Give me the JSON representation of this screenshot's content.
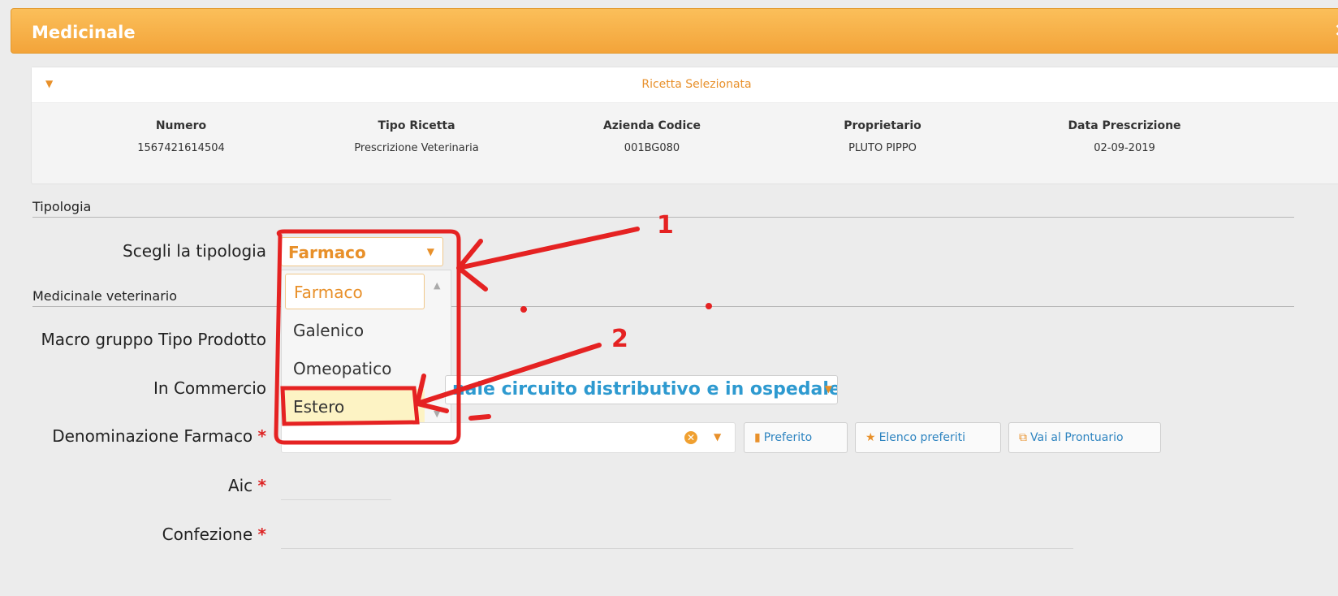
{
  "window": {
    "title": "Medicinale",
    "close_label": "×"
  },
  "ricetta": {
    "header": "Ricetta Selezionata",
    "columns": [
      {
        "label": "Numero",
        "value": "1567421614504"
      },
      {
        "label": "Tipo Ricetta",
        "value": "Prescrizione Veterinaria"
      },
      {
        "label": "Azienda Codice",
        "value": "001BG080"
      },
      {
        "label": "Proprietario",
        "value": "PLUTO PIPPO"
      },
      {
        "label": "Data Prescrizione",
        "value": "02-09-2019"
      }
    ]
  },
  "sections": {
    "tipologia": "Tipologia",
    "medicinale": "Medicinale veterinario"
  },
  "form": {
    "tipologia_label": "Scegli la tipologia",
    "tipologia_value": "Farmaco",
    "tipologia_options": [
      "Farmaco",
      "Galenico",
      "Omeopatico",
      "Estero"
    ],
    "macro_label": "Macro gruppo Tipo Prodotto",
    "commercio_label": "In Commercio",
    "commercio_value": "nale circuito distributivo e in ospedale",
    "denominazione_label": "Denominazione Farmaco",
    "aic_label": "Aic",
    "confezione_label": "Confezione",
    "required_mark": "*"
  },
  "buttons": {
    "preferito": "Preferito",
    "elenco_preferiti": "Elenco preferiti",
    "vai_prontuario": "Vai al Prontuario"
  },
  "annotations": {
    "step1": "1",
    "step2": "2",
    "color": "#e52222"
  },
  "colors": {
    "accent": "#f3a43a",
    "link": "#2e84c0"
  }
}
